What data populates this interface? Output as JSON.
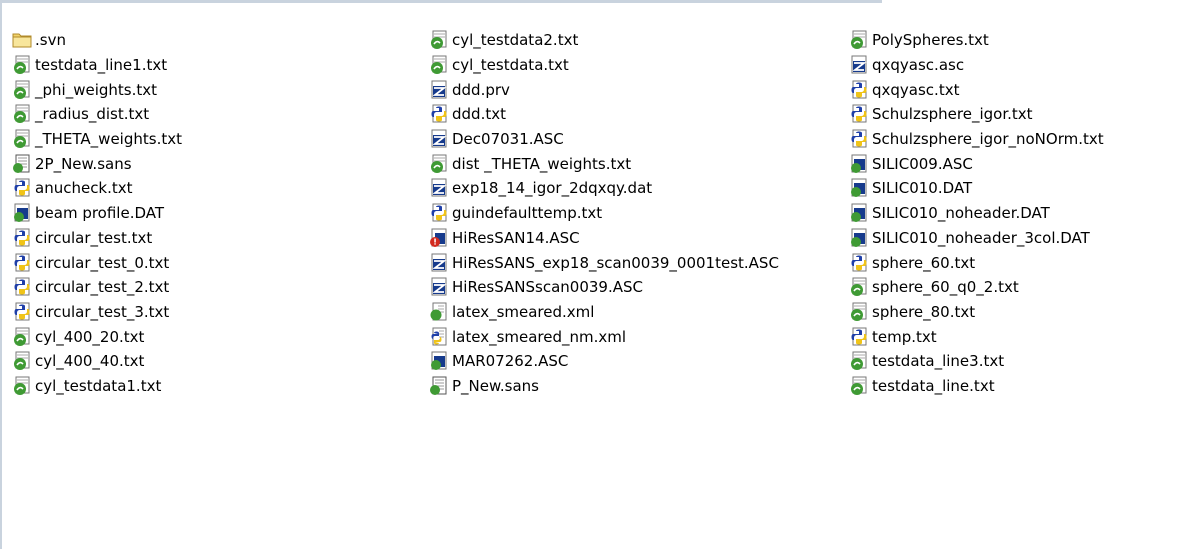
{
  "columns": [
    [
      {
        "name": ".svn",
        "icon": "folder-icon"
      },
      {
        "name": " testdata_line1.txt",
        "icon": "gel-file-icon"
      },
      {
        "name": "_phi_weights.txt",
        "icon": "gel-file-icon"
      },
      {
        "name": "_radius_dist.txt",
        "icon": "gel-file-icon"
      },
      {
        "name": "_THETA_weights.txt",
        "icon": "gel-file-icon"
      },
      {
        "name": "2P_New.sans",
        "icon": "sans-file-icon"
      },
      {
        "name": "anucheck.txt",
        "icon": "python-file-icon"
      },
      {
        "name": "beam profile.DAT",
        "icon": "data-file-icon"
      },
      {
        "name": "circular_test.txt",
        "icon": "python-file-icon"
      },
      {
        "name": "circular_test_0.txt",
        "icon": "python-file-icon"
      },
      {
        "name": "circular_test_2.txt",
        "icon": "python-file-icon"
      },
      {
        "name": "circular_test_3.txt",
        "icon": "python-file-icon"
      },
      {
        "name": "cyl_400_20.txt",
        "icon": "gel-file-icon"
      },
      {
        "name": "cyl_400_40.txt",
        "icon": "gel-file-icon"
      },
      {
        "name": "cyl_testdata1.txt",
        "icon": "gel-file-icon"
      }
    ],
    [
      {
        "name": "cyl_testdata2.txt",
        "icon": "gel-file-icon"
      },
      {
        "name": "cyl_testdata.txt",
        "icon": "gel-file-icon"
      },
      {
        "name": "ddd.prv",
        "icon": "igor-file-icon"
      },
      {
        "name": "ddd.txt",
        "icon": "python-file-icon"
      },
      {
        "name": "Dec07031.ASC",
        "icon": "igor-file-icon"
      },
      {
        "name": "dist _THETA_weights.txt",
        "icon": "gel-file-icon"
      },
      {
        "name": "exp18_14_igor_2dqxqy.dat",
        "icon": "igor-file-icon"
      },
      {
        "name": "guindefaulttemp.txt",
        "icon": "python-file-icon"
      },
      {
        "name": "HiResSAN14.ASC",
        "icon": "error-file-icon"
      },
      {
        "name": "HiResSANS_exp18_scan0039_0001test.ASC",
        "icon": "igor-file-icon"
      },
      {
        "name": "HiResSANSscan0039.ASC",
        "icon": "igor-file-icon"
      },
      {
        "name": "latex_smeared.xml",
        "icon": "xml-gel-file-icon"
      },
      {
        "name": "latex_smeared_nm.xml",
        "icon": "xml-python-file-icon"
      },
      {
        "name": "MAR07262.ASC",
        "icon": "data-file-icon"
      },
      {
        "name": "P_New.sans",
        "icon": "sans-file-icon"
      }
    ],
    [
      {
        "name": "PolySpheres.txt",
        "icon": "gel-file-icon"
      },
      {
        "name": "qxqyasc.asc",
        "icon": "igor-file-icon"
      },
      {
        "name": "qxqyasc.txt",
        "icon": "python-file-icon"
      },
      {
        "name": "Schulzsphere_igor.txt",
        "icon": "python-file-icon"
      },
      {
        "name": "Schulzsphere_igor_noNOrm.txt",
        "icon": "python-file-icon"
      },
      {
        "name": "SILIC009.ASC",
        "icon": "data-file-icon"
      },
      {
        "name": "SILIC010.DAT",
        "icon": "data-file-icon"
      },
      {
        "name": "SILIC010_noheader.DAT",
        "icon": "data-file-icon"
      },
      {
        "name": "SILIC010_noheader_3col.DAT",
        "icon": "data-file-icon"
      },
      {
        "name": "sphere_60.txt",
        "icon": "python-file-icon"
      },
      {
        "name": "sphere_60_q0_2.txt",
        "icon": "gel-file-icon"
      },
      {
        "name": "sphere_80.txt",
        "icon": "gel-file-icon"
      },
      {
        "name": "temp.txt",
        "icon": "python-file-icon"
      },
      {
        "name": "testdata_line3.txt",
        "icon": "gel-file-icon"
      },
      {
        "name": "testdata_line.txt",
        "icon": "gel-file-icon"
      }
    ]
  ],
  "colors": {
    "folder": "#f2d36b",
    "gel": "#3f9a34",
    "python_blue": "#1f3fa8",
    "python_yellow": "#f0c419",
    "igor": "#163a8c",
    "error": "#d22a1e"
  }
}
